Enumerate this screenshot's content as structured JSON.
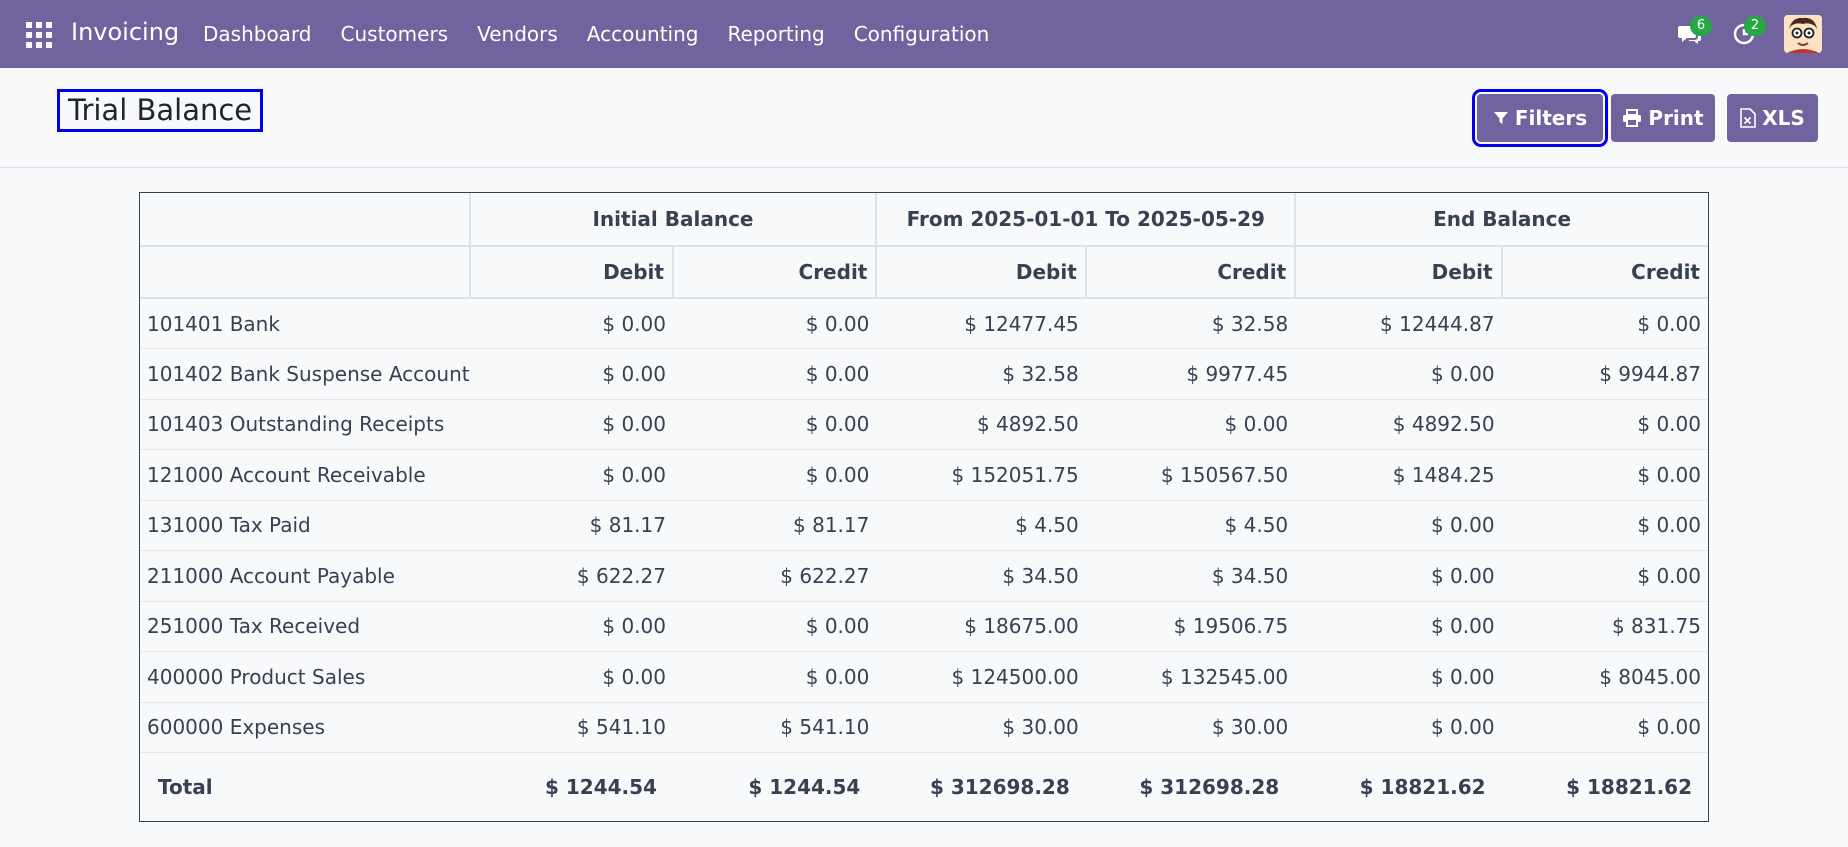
{
  "navbar": {
    "app_name": "Invoicing",
    "menu": [
      "Dashboard",
      "Customers",
      "Vendors",
      "Accounting",
      "Reporting",
      "Configuration"
    ],
    "messages_count": "6",
    "activities_count": "2",
    "background_color": "#71639e"
  },
  "control_panel": {
    "title": "Trial Balance",
    "filters_label": "Filters",
    "print_label": "Print",
    "xls_label": "XLS"
  },
  "table": {
    "group_headers": [
      "Initial Balance",
      "From 2025-01-01 To 2025-05-29",
      "End Balance"
    ],
    "column_headers": [
      "Debit",
      "Credit",
      "Debit",
      "Credit",
      "Debit",
      "Credit"
    ],
    "rows": [
      {
        "account": "101401 Bank",
        "values": [
          "$ 0.00",
          "$ 0.00",
          "$ 12477.45",
          "$ 32.58",
          "$ 12444.87",
          "$ 0.00"
        ]
      },
      {
        "account": "101402 Bank Suspense Account",
        "values": [
          "$ 0.00",
          "$ 0.00",
          "$ 32.58",
          "$ 9977.45",
          "$ 0.00",
          "$ 9944.87"
        ]
      },
      {
        "account": "101403 Outstanding Receipts",
        "values": [
          "$ 0.00",
          "$ 0.00",
          "$ 4892.50",
          "$ 0.00",
          "$ 4892.50",
          "$ 0.00"
        ]
      },
      {
        "account": "121000 Account Receivable",
        "values": [
          "$ 0.00",
          "$ 0.00",
          "$ 152051.75",
          "$ 150567.50",
          "$ 1484.25",
          "$ 0.00"
        ]
      },
      {
        "account": "131000 Tax Paid",
        "values": [
          "$ 81.17",
          "$ 81.17",
          "$ 4.50",
          "$ 4.50",
          "$ 0.00",
          "$ 0.00"
        ]
      },
      {
        "account": "211000 Account Payable",
        "values": [
          "$ 622.27",
          "$ 622.27",
          "$ 34.50",
          "$ 34.50",
          "$ 0.00",
          "$ 0.00"
        ]
      },
      {
        "account": "251000 Tax Received",
        "values": [
          "$ 0.00",
          "$ 0.00",
          "$ 18675.00",
          "$ 19506.75",
          "$ 0.00",
          "$ 831.75"
        ]
      },
      {
        "account": "400000 Product Sales",
        "values": [
          "$ 0.00",
          "$ 0.00",
          "$ 124500.00",
          "$ 132545.00",
          "$ 0.00",
          "$ 8045.00"
        ]
      },
      {
        "account": "600000 Expenses",
        "values": [
          "$ 541.10",
          "$ 541.10",
          "$ 30.00",
          "$ 30.00",
          "$ 0.00",
          "$ 0.00"
        ]
      }
    ],
    "total": {
      "label": "Total",
      "values": [
        "$ 1244.54",
        "$ 1244.54",
        "$ 312698.28",
        "$ 312698.28",
        "$ 18821.62",
        "$ 18821.62"
      ]
    }
  }
}
